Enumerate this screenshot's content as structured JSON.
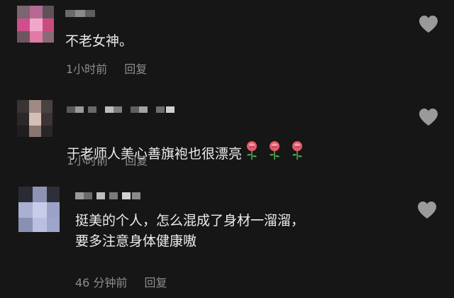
{
  "comments": [
    {
      "text": "不老女神。",
      "time": "1小时前",
      "reply_label": "回复",
      "emoji_count": 0
    },
    {
      "text": "于老师人美心善旗袍也很漂亮",
      "time": "1小时前",
      "reply_label": "回复",
      "emoji": "🌹",
      "emoji_count": 3
    },
    {
      "text": "挺美的个人，怎么混成了身材一溜溜，\n要多注意身体健康嗷",
      "time": "46 分钟前",
      "reply_label": "回复",
      "emoji_count": 0
    }
  ],
  "icons": {
    "like": "heart-outline-icon"
  },
  "colors": {
    "background": "#161616",
    "text": "#ececec",
    "meta": "#8d8d8d",
    "heart": "#9a9a9a"
  }
}
